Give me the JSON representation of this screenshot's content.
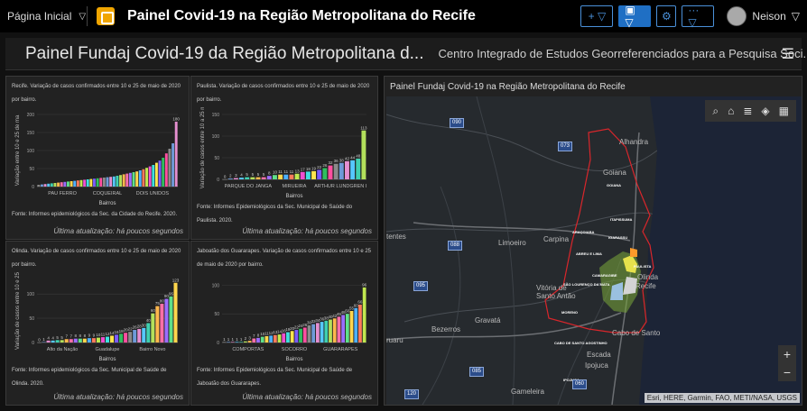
{
  "topbar": {
    "page_menu": "Página Inicial",
    "title": "Painel Covid-19 na Região Metropolitana do Recife",
    "user": "Neison"
  },
  "header": {
    "title": "Painel Fundaj Covid-19 da Região Metropolitana d...",
    "subtitle": "Centro Integrado de Estudos Georreferenciados para a Pesquisa Soci..."
  },
  "charts": [
    {
      "desc": "Recife. Variação de casos confirmados entre 10 e 25 de maio de 2020 por bairro.",
      "source": "Fonte: Informes epidemiológicos da Sec. da Cidade do Recife. 2020.",
      "updated": "Última atualização: há poucos segundos",
      "xlabel": "Bairros",
      "ylabel": "Variação entre 10 e 25 de ma",
      "x_ticks": [
        "PAU FERRO",
        "COQUEIRAL",
        "DOIS UNIDOS"
      ],
      "y_ticks": [
        "0",
        "50",
        "100",
        "150",
        "200"
      ],
      "max_label": "180"
    },
    {
      "desc": "Paulista. Variação de casos confirmados entre 10 e 25 de maio de 2020 por bairro.",
      "source": "Fonte: Informes Epidemiológicos da Sec. Municipal de Saúde do Paulista. 2020.",
      "updated": "Última atualização: há poucos segundos",
      "xlabel": "Bairros",
      "ylabel": "Variação de casos entre 10 a 25 m",
      "x_ticks": [
        "PARQUE DO JANGA",
        "MIRUEIRA",
        "ARTHUR LUNDGREN I"
      ],
      "y_ticks": [
        "0",
        "50",
        "100",
        "150"
      ],
      "max_label": "113"
    },
    {
      "desc": "Olinda. Variação de casos confirmados entre 10 e 25 de maio de 2020 por bairro.",
      "source": "Fonte: Informes epidemiológicos da Sec. Municipal de Saúde de Olinda. 2020.",
      "updated": "Última atualização: há poucos segundos",
      "xlabel": "Bairros",
      "ylabel": "Variação de casos entre 10 e 25",
      "x_ticks": [
        "Alto da Nação",
        "Guadalupe",
        "Bairro Novo"
      ],
      "y_ticks": [
        "0",
        "50",
        "100"
      ],
      "max_label": "123"
    },
    {
      "desc": "Jaboatão dos Guararapes. Variação de casos confirmados entre 10 e 25 de maio de 2020 por bairro.",
      "source": "Fonte: Informes Epidemiológicos da Sec. Municipal de Saúde de Jaboatão dos Guararapes.",
      "updated": "Última atualização: há poucos segundos",
      "xlabel": "Bairros",
      "ylabel": "",
      "x_ticks": [
        "COMPORTAS",
        "SOCORRO",
        "GUARARAPES"
      ],
      "y_ticks": [
        "0",
        "50",
        "100"
      ],
      "max_label": "96"
    }
  ],
  "chart_data": [
    {
      "type": "bar",
      "title": "Recife",
      "xlabel": "Bairros",
      "ylim": [
        0,
        200
      ],
      "values": [
        5,
        6,
        7,
        8,
        9,
        10,
        11,
        12,
        13,
        14,
        15,
        16,
        17,
        18,
        19,
        20,
        21,
        22,
        23,
        24,
        25,
        26,
        27,
        28,
        30,
        32,
        34,
        36,
        38,
        40,
        42,
        45,
        48,
        52,
        56,
        60,
        66,
        72,
        80,
        92,
        105,
        120,
        180
      ]
    },
    {
      "type": "bar",
      "title": "Paulista",
      "xlabel": "Bairros",
      "ylim": [
        0,
        150
      ],
      "values": [
        0,
        2,
        3,
        4,
        5,
        5,
        5,
        5,
        8,
        10,
        11,
        11,
        11,
        13,
        17,
        18,
        19,
        22,
        26,
        32,
        36,
        38,
        42,
        44,
        48,
        113
      ]
    },
    {
      "type": "bar",
      "title": "Olinda",
      "xlabel": "Bairros",
      "ylim": [
        0,
        130
      ],
      "values": [
        0,
        1,
        4,
        4,
        5,
        5,
        7,
        7,
        8,
        8,
        8,
        9,
        9,
        10,
        11,
        12,
        14,
        16,
        18,
        20,
        22,
        26,
        28,
        30,
        40,
        60,
        75,
        80,
        90,
        95,
        123
      ]
    },
    {
      "type": "bar",
      "title": "Jaboatão dos Guararapes",
      "xlabel": "Bairros",
      "ylim": [
        0,
        110
      ],
      "values": [
        1,
        1,
        1,
        1,
        1,
        2,
        3,
        7,
        8,
        10,
        11,
        12,
        13,
        14,
        16,
        18,
        20,
        22,
        24,
        26,
        30,
        32,
        34,
        36,
        38,
        40,
        42,
        45,
        48,
        50,
        55,
        60,
        66,
        96
      ]
    }
  ],
  "map": {
    "title": "Painel Fundaj Covid-19 na Região Metropolitana do Recife",
    "attribution": "Esri, HERE, Garmin, FAO, METI/NASA, USGS",
    "places": [
      "Alhandra",
      "Goiana",
      "Limoeiro",
      "Carpina",
      "Vitória de Santo Antão",
      "Gravatá",
      "Bezerros",
      "Escada",
      "Ipojuca",
      "Gameleira",
      "Cabo de Santo",
      "Recife",
      "Olinda",
      "tentes",
      "ruaru"
    ],
    "city_labels": [
      "GOIANA",
      "ITAPISSUMA",
      "ARAÇOIABA",
      "IGARASSU",
      "ABREU E LIMA",
      "PAULISTA",
      "CAMARAGIBE",
      "SÃO LOURENÇO DA MATA",
      "MORENO",
      "CABO DE SANTO AGOSTINHO",
      "IPOJUCA"
    ],
    "roads": [
      "090",
      "073",
      "088",
      "095",
      "085",
      "120",
      "060"
    ],
    "zoom_in": "+",
    "zoom_out": "−"
  },
  "colors": {
    "accent": "#1f6fc4",
    "boundary": "#d9262b"
  }
}
